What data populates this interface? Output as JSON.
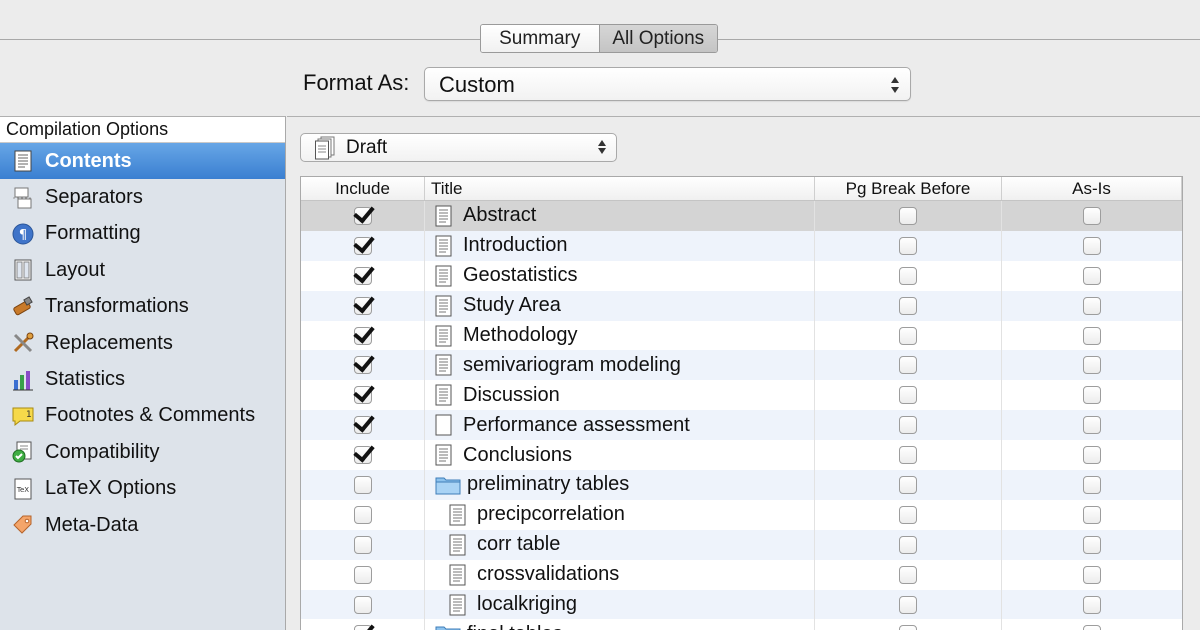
{
  "top_tabs": [
    {
      "label": "Summary",
      "active": false
    },
    {
      "label": "All Options",
      "active": true
    }
  ],
  "format_as": {
    "label": "Format As:",
    "value": "Custom"
  },
  "sidebar": {
    "header": "Compilation Options",
    "items": [
      {
        "label": "Contents",
        "icon": "contents-icon",
        "selected": true
      },
      {
        "label": "Separators",
        "icon": "separators-icon",
        "selected": false
      },
      {
        "label": "Formatting",
        "icon": "formatting-icon",
        "selected": false
      },
      {
        "label": "Layout",
        "icon": "layout-icon",
        "selected": false
      },
      {
        "label": "Transformations",
        "icon": "transformations-icon",
        "selected": false
      },
      {
        "label": "Replacements",
        "icon": "replacements-icon",
        "selected": false
      },
      {
        "label": "Statistics",
        "icon": "statistics-icon",
        "selected": false
      },
      {
        "label": "Footnotes & Comments",
        "icon": "footnotes-icon",
        "selected": false
      },
      {
        "label": "Compatibility",
        "icon": "compatibility-icon",
        "selected": false
      },
      {
        "label": "LaTeX Options",
        "icon": "latex-icon",
        "selected": false
      },
      {
        "label": "Meta-Data",
        "icon": "metadata-tag-icon",
        "selected": false
      }
    ]
  },
  "draft_select": {
    "value": "Draft"
  },
  "table": {
    "columns": [
      "Include",
      "Title",
      "Pg Break Before",
      "As-Is"
    ],
    "rows": [
      {
        "include": true,
        "title": "Abstract",
        "type": "doc",
        "level": 0,
        "pg_break": false,
        "as_is": false
      },
      {
        "include": true,
        "title": "Introduction",
        "type": "doc",
        "level": 0,
        "pg_break": false,
        "as_is": false
      },
      {
        "include": true,
        "title": "Geostatistics",
        "type": "doc",
        "level": 0,
        "pg_break": false,
        "as_is": false
      },
      {
        "include": true,
        "title": "Study Area",
        "type": "doc",
        "level": 0,
        "pg_break": false,
        "as_is": false
      },
      {
        "include": true,
        "title": "Methodology",
        "type": "doc",
        "level": 0,
        "pg_break": false,
        "as_is": false
      },
      {
        "include": true,
        "title": "semivariogram modeling",
        "type": "doc",
        "level": 0,
        "pg_break": false,
        "as_is": false
      },
      {
        "include": true,
        "title": "Discussion",
        "type": "doc",
        "level": 0,
        "pg_break": false,
        "as_is": false
      },
      {
        "include": true,
        "title": "Performance assessment",
        "type": "blank-doc",
        "level": 0,
        "pg_break": false,
        "as_is": false
      },
      {
        "include": true,
        "title": "Conclusions",
        "type": "doc",
        "level": 0,
        "pg_break": false,
        "as_is": false
      },
      {
        "include": false,
        "title": "preliminatry tables",
        "type": "folder",
        "level": 0,
        "pg_break": false,
        "as_is": false
      },
      {
        "include": false,
        "title": "precipcorrelation",
        "type": "doc",
        "level": 1,
        "pg_break": false,
        "as_is": false
      },
      {
        "include": false,
        "title": "corr table",
        "type": "doc",
        "level": 1,
        "pg_break": false,
        "as_is": false
      },
      {
        "include": false,
        "title": "crossvalidations",
        "type": "doc",
        "level": 1,
        "pg_break": false,
        "as_is": false
      },
      {
        "include": false,
        "title": "localkriging",
        "type": "doc",
        "level": 1,
        "pg_break": false,
        "as_is": false
      },
      {
        "include": true,
        "title": "final tables",
        "type": "folder",
        "level": 0,
        "pg_break": false,
        "as_is": false
      }
    ]
  },
  "colors": {
    "selection_blue": "#3a7fd1",
    "sidebar_bg": "#dde3ea",
    "row_alt": "#eef3fb",
    "row_selected": "#d4d4d4"
  }
}
